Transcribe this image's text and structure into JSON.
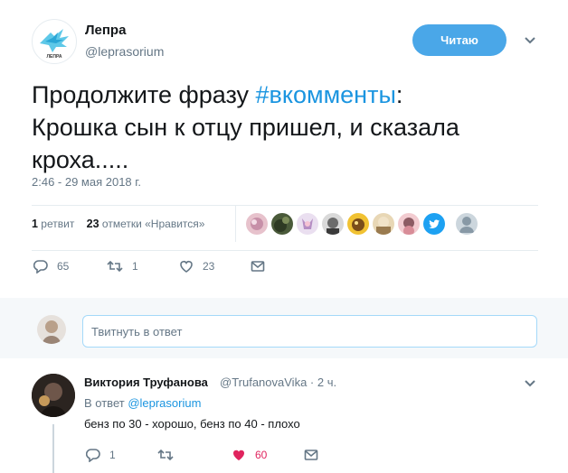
{
  "tweet": {
    "author_name": "Лепра",
    "author_handle": "@leprasorium",
    "follow_label": "Читаю",
    "text_prefix": "Продолжите фразу ",
    "hashtag": "#вкомменты",
    "text_line1_suffix": ":",
    "text_line2": "Крошка сын к отцу пришел, и сказала",
    "text_line3": "кроха.....",
    "timestamp": "2:46 - 29 мая 2018 г.",
    "retweets_count": "1",
    "retweets_label": "ретвит",
    "likes_count": "23",
    "likes_label": "отметки «Нравится»",
    "actions": {
      "replies": "65",
      "retweets": "1",
      "likes": "23"
    },
    "avatar_caption": "ЛЕПРА"
  },
  "reply_composer": {
    "placeholder": "Твитнуть в ответ"
  },
  "reply": {
    "author_name": "Виктория Труфанова",
    "author_handle": "@TrufanovaVika · 2 ч.",
    "in_reply_prefix": "В ответ ",
    "in_reply_handle": "@leprasorium",
    "text": "бенз по 30 - хорошо, бенз по 40 - плохо",
    "actions": {
      "replies": "1",
      "likes": "60"
    }
  },
  "colors": {
    "accent": "#1b95e0",
    "follow_button": "#4aa7e8",
    "like_active": "#e0245e",
    "secondary_text": "#657786"
  }
}
